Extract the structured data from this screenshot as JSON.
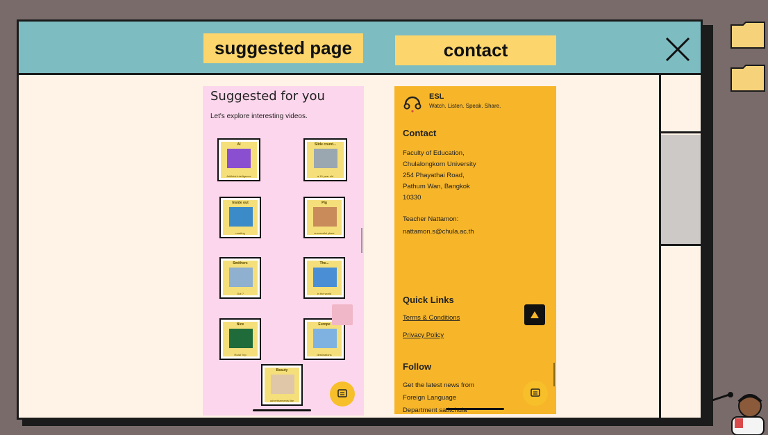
{
  "tabs": {
    "suggested": "suggested page",
    "contact": "contact"
  },
  "suggested": {
    "title": "Suggested for you",
    "subtitle": "Let's explore interesting videos.",
    "videos": [
      {
        "title": "AI",
        "caption": "Artificial intelligence"
      },
      {
        "title": "Slide count...",
        "caption": "a 10 year old"
      },
      {
        "title": "Inside out",
        "caption": "reading"
      },
      {
        "title": "Pig",
        "caption": "successful place"
      },
      {
        "title": "Smithers",
        "caption": "Got ?"
      },
      {
        "title": "The...",
        "caption": "in the world"
      },
      {
        "title": "Nice",
        "caption": "Road Trip"
      },
      {
        "title": "Europe",
        "caption": "destinations"
      },
      {
        "title": "Beauty",
        "caption": "advertisements like"
      }
    ]
  },
  "contact": {
    "brand": "ESL",
    "tagline": "Watch. Listen. Speak. Share.",
    "contact_heading": "Contact",
    "address": [
      "Faculty of Education,",
      "Chulalongkorn University",
      "254 Phayathai Road,",
      "Pathum Wan, Bangkok",
      "10330"
    ],
    "teacher": "Teacher Nattamon:",
    "email": "nattamon.s@chula.ac.th",
    "quick_links_heading": "Quick Links",
    "terms": "Terms & Conditions",
    "privacy": "Privacy Policy",
    "follow_heading": "Follow",
    "follow_lines": [
      "Get the latest news from",
      "Foreign Language",
      "Department satitchula"
    ]
  },
  "colors": {
    "titlebar": "#7dbcc1",
    "tab": "#fcd56c",
    "suggest_bg": "#fcd6ec",
    "contact_bg": "#f7b62a",
    "window_bg": "#fff3e7"
  },
  "icons": [
    "close-icon",
    "chat-icon",
    "arrow-up-icon",
    "headset-icon",
    "folder-icon"
  ]
}
